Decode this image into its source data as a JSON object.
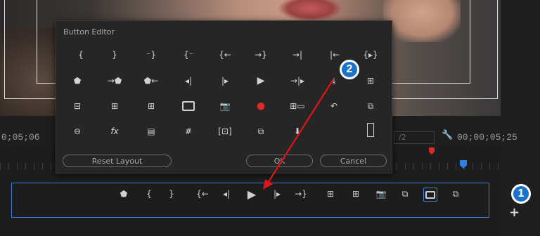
{
  "dialog": {
    "title": "Button Editor",
    "reset_label": "Reset Layout",
    "ok_label": "OK",
    "cancel_label": "Cancel",
    "grid": [
      [
        "{",
        "}",
        "⁻}",
        "{⁻",
        "{←",
        "→}",
        "→|",
        "|←",
        "{▸}"
      ],
      [
        "⬟",
        "→⬟",
        "⬟←",
        "◂|",
        "|▸",
        "▶",
        "→|▸",
        "⤓",
        "⊞"
      ],
      [
        "⊟",
        "⊞",
        "⊞",
        "▭",
        "📷",
        "●",
        "⊞▭",
        "↶",
        "⧉"
      ],
      [
        "⊖",
        "fx",
        "▤",
        "#",
        "[⊡]",
        "⧉",
        "⬇",
        "",
        "▯"
      ]
    ]
  },
  "monitor": {
    "timecode_left": "0;05;06",
    "timecode_right": "00;00;05;25",
    "zoom_value": "/2"
  },
  "button_bar": {
    "icons": [
      "⬟",
      "{",
      "}",
      "{←",
      "◂|",
      "▶",
      "|▸",
      "→}",
      "⊞",
      "⊞",
      "📷",
      "⧉",
      "▭",
      "⧉"
    ]
  },
  "callouts": {
    "one": "1",
    "two": "2"
  },
  "add_button_label": "+",
  "colors": {
    "accent": "#1a73c8",
    "selection_border": "#3d7fdb",
    "record": "#e02a2a",
    "arrow": "#e0151b"
  }
}
